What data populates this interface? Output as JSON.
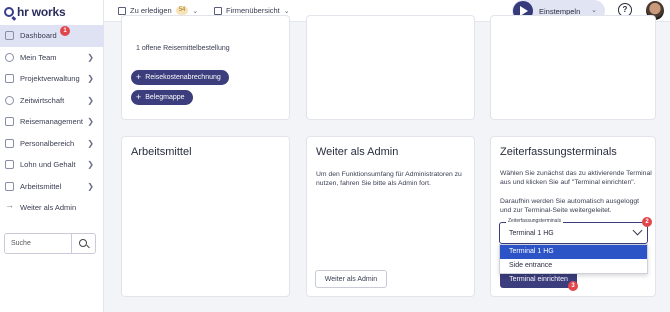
{
  "brand": {
    "name": "hr works"
  },
  "sidebar": {
    "items": [
      {
        "label": "Dashboard",
        "badge": "1"
      },
      {
        "label": "Mein Team"
      },
      {
        "label": "Projektverwaltung"
      },
      {
        "label": "Zeitwirtschaft"
      },
      {
        "label": "Reisemanagement"
      },
      {
        "label": "Personalbereich"
      },
      {
        "label": "Lohn und Gehalt"
      },
      {
        "label": "Arbeitsmittel"
      },
      {
        "label": "Weiter als Admin"
      }
    ],
    "search_placeholder": "Suche"
  },
  "topbar": {
    "todo_label": "Zu erledigen",
    "todo_count": "54",
    "company_label": "Firmenübersicht",
    "clock_in_label": "Einstempeln",
    "help_symbol": "?"
  },
  "travel_card": {
    "pending_text": "1 offene Reisemittelbestellung",
    "buttons": [
      "Reisekostenabrechnung",
      "Belegmappe"
    ]
  },
  "arbeitsmittel_card": {
    "title": "Arbeitsmittel"
  },
  "admin_card": {
    "title": "Weiter als Admin",
    "text": "Um den Funktionsumfang für Administratoren zu nutzen, fahren Sie bitte als Admin fort.",
    "button": "Weiter als Admin"
  },
  "terminal_card": {
    "title": "Zeiterfassungsterminals",
    "text1": "Wählen Sie zunächst das zu aktivierende Terminal aus und klicken Sie auf \"Terminal einrichten\".",
    "text2": "Daraufhin werden Sie automatisch ausgeloggt und zur Terminal-Seite weitergeleitet.",
    "select_label": "Zeiterfassungsterminals",
    "select_value": "Terminal 1 HG",
    "options": [
      "Terminal 1 HG",
      "Side entrance"
    ],
    "button": "Terminal einrichten",
    "badge_select": "2",
    "badge_button": "3"
  },
  "colors": {
    "accent": "#3b3d7d",
    "badge": "#e0474c",
    "selected_option": "#2d54c6"
  }
}
